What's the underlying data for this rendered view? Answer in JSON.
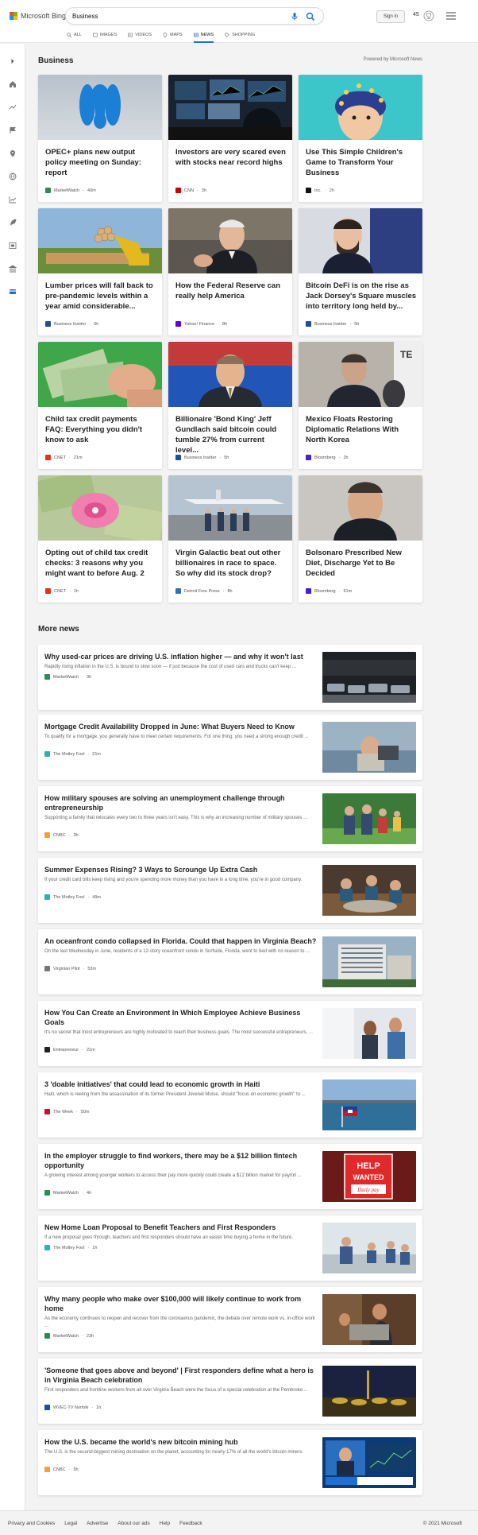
{
  "header": {
    "logo_text": "Microsoft Bing",
    "search_value": "Business",
    "sign_in_label": "Sign in",
    "points": "45",
    "tabs": [
      {
        "label": "ALL",
        "icon": "search-icon"
      },
      {
        "label": "IMAGES",
        "icon": "image-icon"
      },
      {
        "label": "VIDEOS",
        "icon": "video-icon"
      },
      {
        "label": "MAPS",
        "icon": "map-pin-icon"
      },
      {
        "label": "NEWS",
        "icon": "news-icon"
      },
      {
        "label": "SHOPPING",
        "icon": "tag-icon"
      }
    ],
    "active_tab": "NEWS",
    "accent_color": "#1f6fd1"
  },
  "sidebar": {
    "items": [
      "expand-icon",
      "home-icon",
      "trending-icon",
      "flag-icon",
      "location-pin-icon",
      "globe-icon",
      "business-chart-icon",
      "rocket-icon",
      "film-icon",
      "bank-icon",
      "card-icon"
    ],
    "active_color": "#1f6fd1"
  },
  "business": {
    "title": "Business",
    "powered_by": "Powered by Microsoft News",
    "cards": [
      {
        "title": "OPEC+ plans new output policy meeting on Sunday: report",
        "source": "MarketWatch",
        "time": "40m",
        "fav_color": "#2e8b57"
      },
      {
        "title": "Investors are very scared even with stocks near record highs",
        "source": "CNN",
        "time": "3h",
        "fav_color": "#cc0000"
      },
      {
        "title": "Use This Simple Children's Game to Transform Your Business",
        "source": "Inc.",
        "time": "2h",
        "fav_color": "#111111"
      },
      {
        "title": "Lumber prices will fall back to pre-pandemic levels within a year amid considerable...",
        "source": "Business Insider",
        "time": "6h",
        "fav_color": "#1f4e9a"
      },
      {
        "title": "How the Federal Reserve can really help America",
        "source": "Yahoo! Finance",
        "time": "8h",
        "fav_color": "#6001d2"
      },
      {
        "title": "Bitcoin DeFi is on the rise as Jack Dorsey's Square muscles into territory long held by...",
        "source": "Business Insider",
        "time": "5h",
        "fav_color": "#1f4e9a"
      },
      {
        "title": "Child tax credit payments FAQ: Everything you didn't know to ask",
        "source": "CNET",
        "time": "21m",
        "fav_color": "#e0321e"
      },
      {
        "title": "Billionaire 'Bond King' Jeff Gundlach said bitcoin could tumble 27% from current level...",
        "source": "Business Insider",
        "time": "5h",
        "fav_color": "#1f4e9a"
      },
      {
        "title": "Mexico Floats Restoring Diplomatic Relations With North Korea",
        "source": "Bloomberg",
        "time": "2h",
        "fav_color": "#4b1fd1"
      },
      {
        "title": "Opting out of child tax credit checks: 3 reasons why you might want to before Aug. 2",
        "source": "CNET",
        "time": "1h",
        "fav_color": "#e0321e"
      },
      {
        "title": "Virgin Galactic beat out other billionaires in race to space. So why did its stock drop?",
        "source": "Detroit Free Press",
        "time": "8h",
        "fav_color": "#3a6fb0"
      },
      {
        "title": "Bolsonaro Prescribed New Diet, Discharge Yet to Be Decided",
        "source": "Bloomberg",
        "time": "51m",
        "fav_color": "#4b1fd1"
      }
    ]
  },
  "more_news": {
    "title": "More news",
    "items": [
      {
        "title": "Why used-car prices are driving U.S. inflation higher — and why it won't last",
        "desc": "Rapidly rising inflation in the U.S. is bound to slow soon — if just because the cost of used cars and trucks can't keep ...",
        "source": "MarketWatch",
        "time": "3h",
        "fav_color": "#2e8b57"
      },
      {
        "title": "Mortgage Credit Availability Dropped in June: What Buyers Need to Know",
        "desc": "To qualify for a mortgage, you generally have to meet certain requirements. For one thing, you need a strong enough credit ...",
        "source": "The Motley Fool",
        "time": "21m",
        "fav_color": "#2bb3b1"
      },
      {
        "title": "How military spouses are solving an unemployment challenge through entrepreneurship",
        "desc": "Supporting a family that relocates every two to three years isn't easy. This is why an increasing number of military spouses ...",
        "source": "CNBC",
        "time": "3h",
        "fav_color": "#e8a33d"
      },
      {
        "title": "Summer Expenses Rising? 3 Ways to Scrounge Up Extra Cash",
        "desc": "If your credit card bills keep rising and you're spending more money than you have in a long time, you're in good company.",
        "source": "The Motley Fool",
        "time": "49m",
        "fav_color": "#2bb3b1"
      },
      {
        "title": "An oceanfront condo collapsed in Florida. Could that happen in Virginia Beach?",
        "desc": "On the last Wednesday in June, residents of a 12-story oceanfront condo in Surfside, Florida, went to bed with no reason to ...",
        "source": "Virginian Pilot",
        "time": "53m",
        "fav_color": "#777777"
      },
      {
        "title": "How You Can Create an Environment In Which Employee Achieve Business Goals",
        "desc": "It's no secret that most entrepreneurs are highly motivated to reach their business goals. The most successful entrepreneurs, ...",
        "source": "Entrepreneur",
        "time": "21m",
        "fav_color": "#222222"
      },
      {
        "title": "3 'doable initiatives' that could lead to economic growth in Haiti",
        "desc": "Haiti, which is reeling from the assassination of its former President Jovenel Moïse, should \"focus on economic growth\" to ...",
        "source": "The Week",
        "time": "50m",
        "fav_color": "#c8102e"
      },
      {
        "title": "In the employer struggle to find workers, there may be a $12 billion fintech opportunity",
        "desc": "A growing interest among younger workers to access their pay more quickly could create a $12 billion market for payroll ...",
        "source": "MarketWatch",
        "time": "4h",
        "fav_color": "#2e8b57"
      },
      {
        "title": "New Home Loan Proposal to Benefit Teachers and First Responders",
        "desc": "If a new proposal goes through, teachers and first responders should have an easier time buying a home in the future.",
        "source": "The Motley Fool",
        "time": "1h",
        "fav_color": "#2bb3b1"
      },
      {
        "title": "Why many people who make over $100,000 will likely continue to work from home",
        "desc": "As the economy continues to reopen and recover from the coronavirus pandemic, the debate over remote work vs. in-office work ...",
        "source": "MarketWatch",
        "time": "23h",
        "fav_color": "#2e8b57"
      },
      {
        "title": "'Someone that goes above and beyond' | First responders define what a hero is in Virginia Beach celebration",
        "desc": "First responders and frontline workers from all over Virginia Beach were the focus of a special celebration at the Pembroke ...",
        "source": "WVEC-TV Norfolk",
        "time": "1h",
        "fav_color": "#1f4e9a"
      },
      {
        "title": "How the U.S. became the world's new bitcoin mining hub",
        "desc": "The U.S. is the second-biggest mining destination on the planet, accounting for nearly 17% of all the world's bitcoin miners.",
        "source": "CNBC",
        "time": "5h",
        "fav_color": "#e8a33d"
      }
    ]
  },
  "footer": {
    "links": [
      "Privacy and Cookies",
      "Legal",
      "Advertise",
      "About our ads",
      "Help",
      "Feedback"
    ],
    "copyright": "© 2021 Microsoft"
  }
}
